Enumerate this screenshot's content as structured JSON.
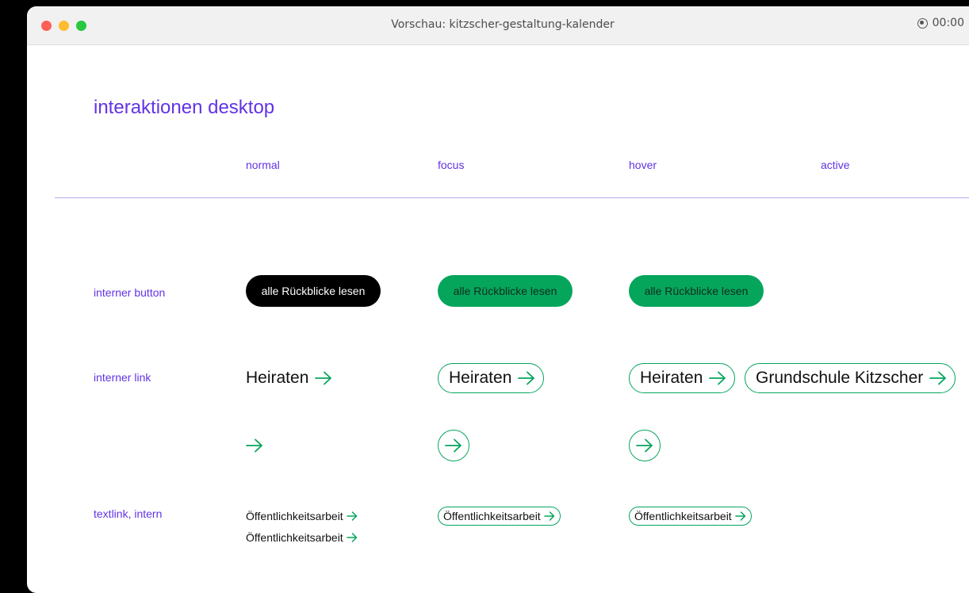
{
  "window": {
    "title": "Vorschau: kitzscher-gestaltung-kalender",
    "recording_time": "00:00"
  },
  "page": {
    "title": "interaktionen desktop"
  },
  "columns": [
    "normal",
    "focus",
    "hover",
    "active"
  ],
  "rows": {
    "button": "interner button",
    "link": "interner link",
    "textlink": "textlink, intern"
  },
  "button_label": "alle Rückblicke lesen",
  "link": {
    "label": "Heiraten",
    "hover_extra_label": "Grundschule Kitzscher"
  },
  "textlink_label": "Öffentlichkeitsarbeit",
  "icons": {
    "arrow": "arrow-right-icon",
    "record": "record-icon"
  },
  "colors": {
    "accent": "#6233e6",
    "green": "#06a55c",
    "black": "#000000"
  }
}
